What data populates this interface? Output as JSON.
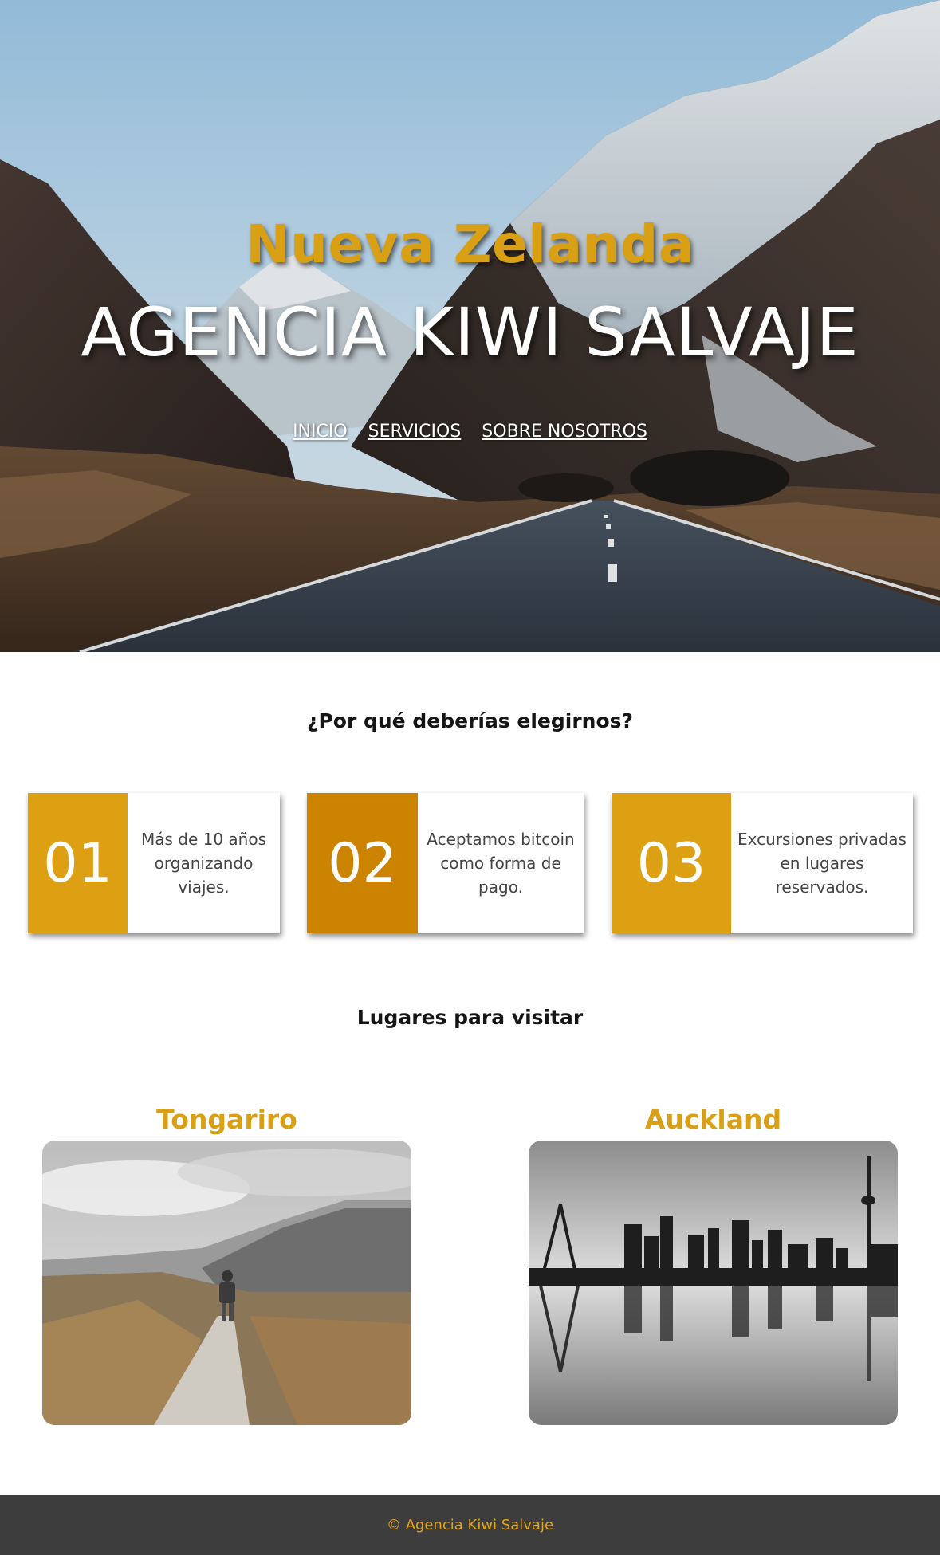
{
  "colors": {
    "accent": "#d9a015",
    "accent_dark": "#cc8400",
    "footer_bg": "#3d3d3d",
    "footer_text": "#e6a519"
  },
  "hero": {
    "subtitle": "Nueva Zelanda",
    "title": "AGENCIA KIWI SALVAJE",
    "nav": [
      {
        "label": "INICIO"
      },
      {
        "label": "SERVICIOS"
      },
      {
        "label": "SOBRE NOSOTROS"
      }
    ]
  },
  "why": {
    "heading": "¿Por qué deberías elegirnos?",
    "cards": [
      {
        "number": "01",
        "text": "Más de 10 años\norganizando viajes.",
        "color": "#dca012"
      },
      {
        "number": "02",
        "text": "Aceptamos bitcoin\ncomo forma de pago.",
        "color": "#cc8400"
      },
      {
        "number": "03",
        "text": "Excursiones privadas\nen lugares reservados.",
        "color": "#dca012"
      }
    ]
  },
  "places": {
    "heading": "Lugares para visitar",
    "items": [
      {
        "name": "Tongariro",
        "image": "hiker-on-trail-photo"
      },
      {
        "name": "Auckland",
        "image": "city-skyline-reflection-photo"
      }
    ]
  },
  "footer": {
    "text": "© Agencia Kiwi Salvaje"
  }
}
